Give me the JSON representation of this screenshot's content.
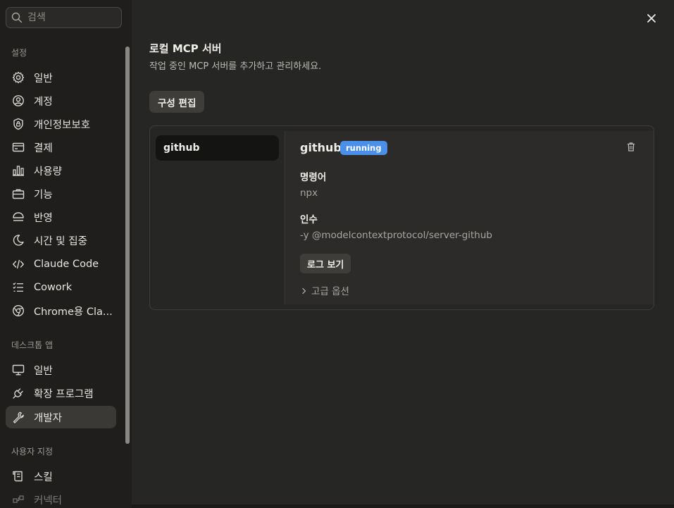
{
  "search": {
    "placeholder": "검색"
  },
  "sidebar": {
    "sections": [
      {
        "label": "설정"
      },
      {
        "label": "데스크톱 앱"
      },
      {
        "label": "사용자 지정"
      }
    ],
    "settings_items": [
      {
        "label": "일반",
        "icon": "gear-icon"
      },
      {
        "label": "계정",
        "icon": "user-circle-icon"
      },
      {
        "label": "개인정보보호",
        "icon": "shield-lock-icon"
      },
      {
        "label": "결제",
        "icon": "credit-card-icon"
      },
      {
        "label": "사용량",
        "icon": "bar-chart-icon"
      },
      {
        "label": "기능",
        "icon": "briefcase-icon"
      },
      {
        "label": "반영",
        "icon": "umbrella-icon"
      },
      {
        "label": "시간 및 집중",
        "icon": "moon-icon"
      },
      {
        "label": "Claude Code",
        "icon": "code-icon"
      },
      {
        "label": "Cowork",
        "icon": "checklist-icon"
      },
      {
        "label": "Chrome용 Cla...",
        "icon": "globe-icon"
      }
    ],
    "desktop_items": [
      {
        "label": "일반",
        "icon": "monitor-icon"
      },
      {
        "label": "확장 프로그램",
        "icon": "plug-icon"
      },
      {
        "label": "개발자",
        "icon": "wrench-icon",
        "active": true
      }
    ],
    "custom_items": [
      {
        "label": "스킬",
        "icon": "scroll-icon"
      },
      {
        "label": "커넥터",
        "icon": "connector-icon"
      }
    ]
  },
  "main": {
    "title": "로컬 MCP 서버",
    "subtitle": "작업 중인 MCP 서버를 추가하고 관리하세요.",
    "edit_config_label": "구성 편집",
    "servers": [
      {
        "name": "github"
      }
    ],
    "detail": {
      "name": "github",
      "status": "running",
      "status_color": "#4a8fe8",
      "command_label": "명령어",
      "command_value": "npx",
      "args_label": "인수",
      "args_value": "-y @modelcontextprotocol/server-github",
      "logs_label": "로그 보기",
      "advanced_label": "고급 옵션"
    }
  }
}
